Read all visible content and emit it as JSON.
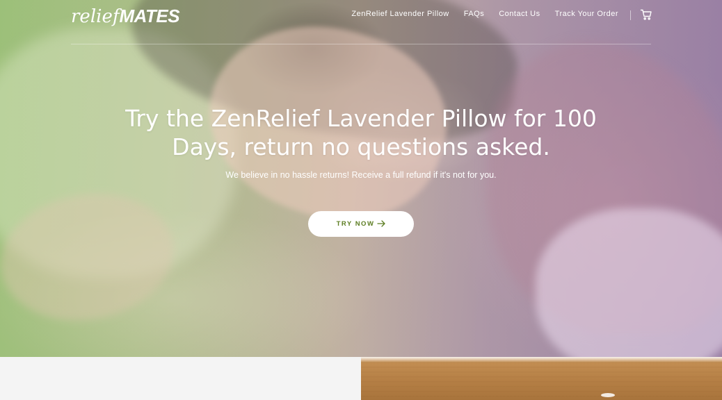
{
  "brand": {
    "logo_light": "relief",
    "logo_bold": "MATES"
  },
  "nav": {
    "items": [
      {
        "label": "ZenRelief Lavender Pillow"
      },
      {
        "label": "FAQs"
      },
      {
        "label": "Contact Us"
      },
      {
        "label": "Track Your Order"
      }
    ],
    "cart_icon": "cart-icon"
  },
  "hero": {
    "title": "Try the ZenRelief Lavender Pillow for 100 Days, return no questions asked.",
    "subtitle": "We believe in no hassle returns! Receive a full refund if it's not for you.",
    "cta_label": "TRY NOW",
    "cta_icon": "arrow-right-icon"
  },
  "colors": {
    "accent": "#5c7d22",
    "overlay_left": "#a8c689",
    "overlay_right": "#a892ac",
    "panel_left": "#f4f4f4",
    "wood": "#b57f45"
  }
}
